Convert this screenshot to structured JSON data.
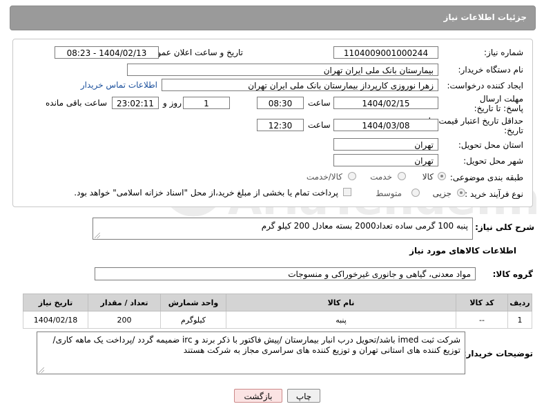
{
  "header": {
    "title": "جزئیات اطلاعات نیاز"
  },
  "fields": {
    "need_number_label": "شماره نیاز:",
    "need_number": "1104009001000244",
    "announce_label": "تاریخ و ساعت اعلان عمومی:",
    "announce_value": "1404/02/13 - 08:23",
    "buyer_org_label": "نام دستگاه خریدار:",
    "buyer_org": "بیمارستان بانک ملی ایران تهران",
    "requester_label": "ایجاد کننده درخواست:",
    "requester": "زهرا نوروزی کارپرداز بیمارستان بانک ملی ایران تهران",
    "contact_link": "اطلاعات تماس خریدار",
    "reply_deadline_label": "مهلت ارسال پاسخ: تا تاریخ:",
    "reply_date": "1404/02/15",
    "time_label": "ساعت",
    "reply_time": "08:30",
    "days_value": "1",
    "days_label": "روز و",
    "remaining_time": "23:02:11",
    "remaining_label": "ساعت باقی مانده",
    "price_validity_label": "حداقل تاریخ اعتبار قیمت: تا تاریخ:",
    "price_date": "1404/03/08",
    "price_time": "12:30",
    "province_label": "استان محل تحویل:",
    "province": "تهران",
    "city_label": "شهر محل تحویل:",
    "city": "تهران",
    "category_label": "طبقه بندی موضوعی:",
    "category_options": [
      "کالا",
      "خدمت",
      "کالا/خدمت"
    ],
    "purchase_type_label": "نوع فرآیند خرید :",
    "purchase_options": [
      "جزیی",
      "متوسط"
    ],
    "payment_note": "پرداخت تمام یا بخشی از مبلغ خرید،از محل \"اسناد خزانه اسلامی\" خواهد بود."
  },
  "summary": {
    "label": "شرح کلی نیاز:",
    "text": "پنبه 100 گرمی ساده تعداد2000 بسته معادل 200 کیلو گرم"
  },
  "goods": {
    "section_title": "اطلاعات کالاهای مورد نیاز",
    "group_label": "گروه کالا:",
    "group_value": "مواد معدنی، گیاهی و جانوری غیرخوراکی و منسوجات",
    "columns": [
      "ردیف",
      "کد کالا",
      "نام کالا",
      "واحد شمارش",
      "تعداد / مقدار",
      "تاریخ نیاز"
    ],
    "rows": [
      [
        "1",
        "--",
        "پنبه",
        "کیلوگرم",
        "200",
        "1404/02/18"
      ]
    ]
  },
  "buyer_notes": {
    "label": "توضیحات خریدار:",
    "text": "شرکت ثبت imed باشد/تحویل درب انبار بیمارستان /پیش فاکتور با ذکر برند و irc ضمیمه گردد /پرداخت یک ماهه کاری/ توزیع کننده های استانی تهران و توزیع کننده های سراسری مجاز به شرکت هستند"
  },
  "buttons": {
    "print": "چاپ",
    "back": "بازگشت"
  },
  "watermark": {
    "text": "AriaTender.net"
  },
  "colors": {
    "header_bg": "#9a9a9a",
    "link": "#1a4f9c",
    "table_header": "#d4d4d4"
  }
}
